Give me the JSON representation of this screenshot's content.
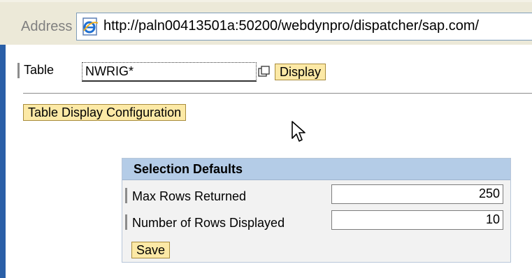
{
  "browser": {
    "address_label": "Address",
    "url": "http://paln00413501a:50200/webdynpro/dispatcher/sap.com/"
  },
  "table_field": {
    "label": "Table",
    "value": "NWRIG*",
    "display_button": "Display"
  },
  "config_button": "Table Display Configuration",
  "selection_defaults": {
    "title": "Selection Defaults",
    "max_rows_label": "Max Rows Returned",
    "max_rows_value": "250",
    "rows_displayed_label": "Number of Rows Displayed",
    "rows_displayed_value": "10",
    "save_button": "Save"
  },
  "colors": {
    "panel_header": "#b4cce7",
    "button_fill": "#fce9a6",
    "left_edge": "#2a5fa7"
  },
  "icons": [
    "ie-page-icon",
    "value-help-icon",
    "mouse-pointer-icon"
  ]
}
